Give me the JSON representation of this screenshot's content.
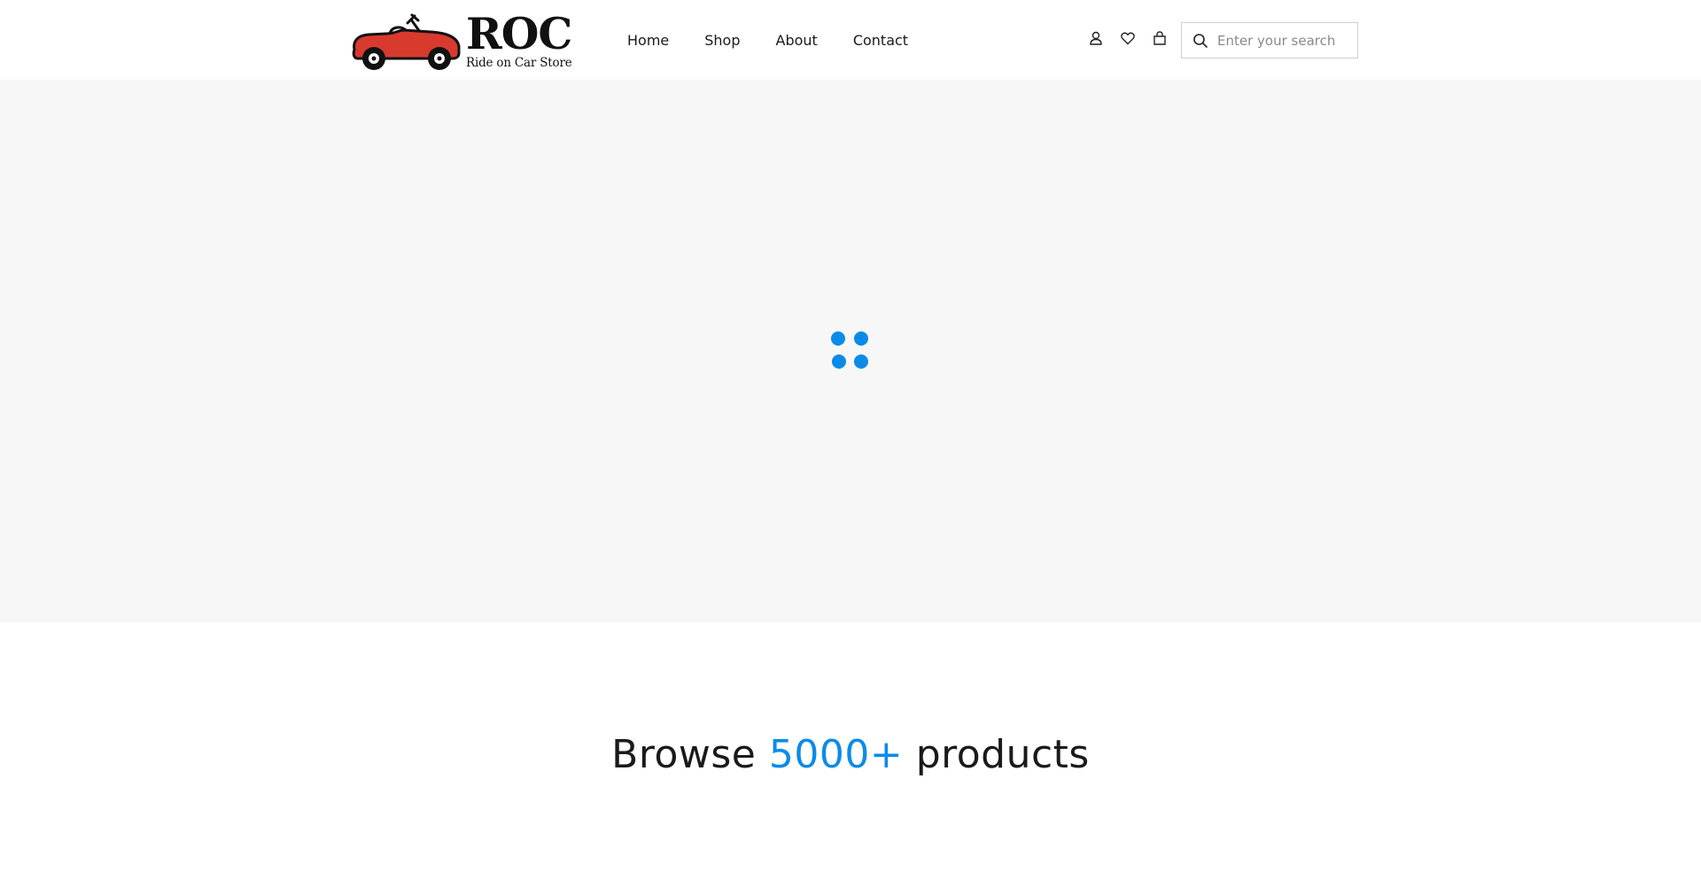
{
  "brand": {
    "name": "ROC",
    "tagline": "Ride on Car Store",
    "car_color": "#d83a2e"
  },
  "nav": {
    "items": [
      "Home",
      "Shop",
      "About",
      "Contact"
    ]
  },
  "header_icons": [
    "user-icon",
    "heart-icon",
    "bag-icon"
  ],
  "search": {
    "placeholder": "Enter your search",
    "value": ""
  },
  "hero": {
    "background": "#f7f7f7",
    "loader_color": "#0b8be8"
  },
  "browse": {
    "prefix": "Browse",
    "count": "5000+",
    "suffix": "products",
    "accent_color": "#0b8be8"
  }
}
